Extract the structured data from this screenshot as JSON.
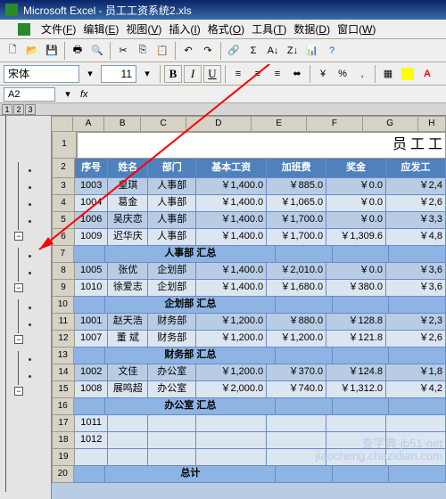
{
  "title": "Microsoft Excel - 员工工资系统2.xls",
  "menu": {
    "items": [
      "文件(F)",
      "编辑(E)",
      "视图(V)",
      "插入(I)",
      "格式(O)",
      "工具(T)",
      "数据(D)",
      "窗口(W)"
    ]
  },
  "font": {
    "name": "宋体",
    "size": "11"
  },
  "nameBox": "A2",
  "outlineLevels": [
    "1",
    "2",
    "3"
  ],
  "columns": [
    "A",
    "B",
    "C",
    "D",
    "E",
    "F",
    "G",
    "H"
  ],
  "title_row": {
    "text": "员 工 工"
  },
  "header": [
    "序号",
    "姓名",
    "部门",
    "基本工资",
    "加班费",
    "奖金",
    "应发工"
  ],
  "rows": [
    {
      "n": 3,
      "type": "data",
      "alt": false,
      "c": [
        "1003",
        "皇琪",
        "人事部",
        "￥1,400.0",
        "￥885.0",
        "￥0.0",
        "￥2,4"
      ]
    },
    {
      "n": 4,
      "type": "data",
      "alt": true,
      "c": [
        "1004",
        "葛金",
        "人事部",
        "￥1,400.0",
        "￥1,065.0",
        "￥0.0",
        "￥2,6"
      ]
    },
    {
      "n": 5,
      "type": "data",
      "alt": false,
      "c": [
        "1006",
        "吴庆恋",
        "人事部",
        "￥1,400.0",
        "￥1,700.0",
        "￥0.0",
        "￥3,3"
      ]
    },
    {
      "n": 6,
      "type": "data",
      "alt": true,
      "c": [
        "1009",
        "迟华庆",
        "人事部",
        "￥1,400.0",
        "￥1,700.0",
        "￥1,309.6",
        "￥4,8"
      ]
    },
    {
      "n": 7,
      "type": "sub",
      "text": "人事部 汇总"
    },
    {
      "n": 8,
      "type": "data",
      "alt": false,
      "c": [
        "1005",
        "张优",
        "企划部",
        "￥1,400.0",
        "￥2,010.0",
        "￥0.0",
        "￥3,6"
      ]
    },
    {
      "n": 9,
      "type": "data",
      "alt": true,
      "c": [
        "1010",
        "徐爱志",
        "企划部",
        "￥1,400.0",
        "￥1,680.0",
        "￥380.0",
        "￥3,6"
      ]
    },
    {
      "n": 10,
      "type": "sub",
      "text": "企划部 汇总"
    },
    {
      "n": 11,
      "type": "data",
      "alt": false,
      "c": [
        "1001",
        "赵天浩",
        "财务部",
        "￥1,200.0",
        "￥880.0",
        "￥128.8",
        "￥2,3"
      ]
    },
    {
      "n": 12,
      "type": "data",
      "alt": true,
      "c": [
        "1007",
        "董 斌",
        "财务部",
        "￥1,200.0",
        "￥1,200.0",
        "￥121.8",
        "￥2,6"
      ]
    },
    {
      "n": 13,
      "type": "sub",
      "text": "财务部 汇总"
    },
    {
      "n": 14,
      "type": "data",
      "alt": false,
      "c": [
        "1002",
        "文佳",
        "办公室",
        "￥1,200.0",
        "￥370.0",
        "￥124.8",
        "￥1,8"
      ]
    },
    {
      "n": 15,
      "type": "data",
      "alt": true,
      "c": [
        "1008",
        "展鸣超",
        "办公室",
        "￥2,000.0",
        "￥740.0",
        "￥1,312.0",
        "￥4,2"
      ]
    },
    {
      "n": 16,
      "type": "sub",
      "text": "办公室 汇总"
    },
    {
      "n": 17,
      "type": "empty",
      "c": [
        "1011",
        "",
        "",
        "",
        "",
        "",
        ""
      ]
    },
    {
      "n": 18,
      "type": "empty",
      "c": [
        "1012",
        "",
        "",
        "",
        "",
        "",
        ""
      ]
    },
    {
      "n": 19,
      "type": "empty",
      "c": [
        "",
        "",
        "",
        "",
        "",
        "",
        ""
      ]
    },
    {
      "n": 20,
      "type": "sub",
      "text": "总计"
    }
  ],
  "watermark": {
    "line1": "查字典·jb51·net",
    "line2": "jiaocheng.chazidian.com"
  }
}
